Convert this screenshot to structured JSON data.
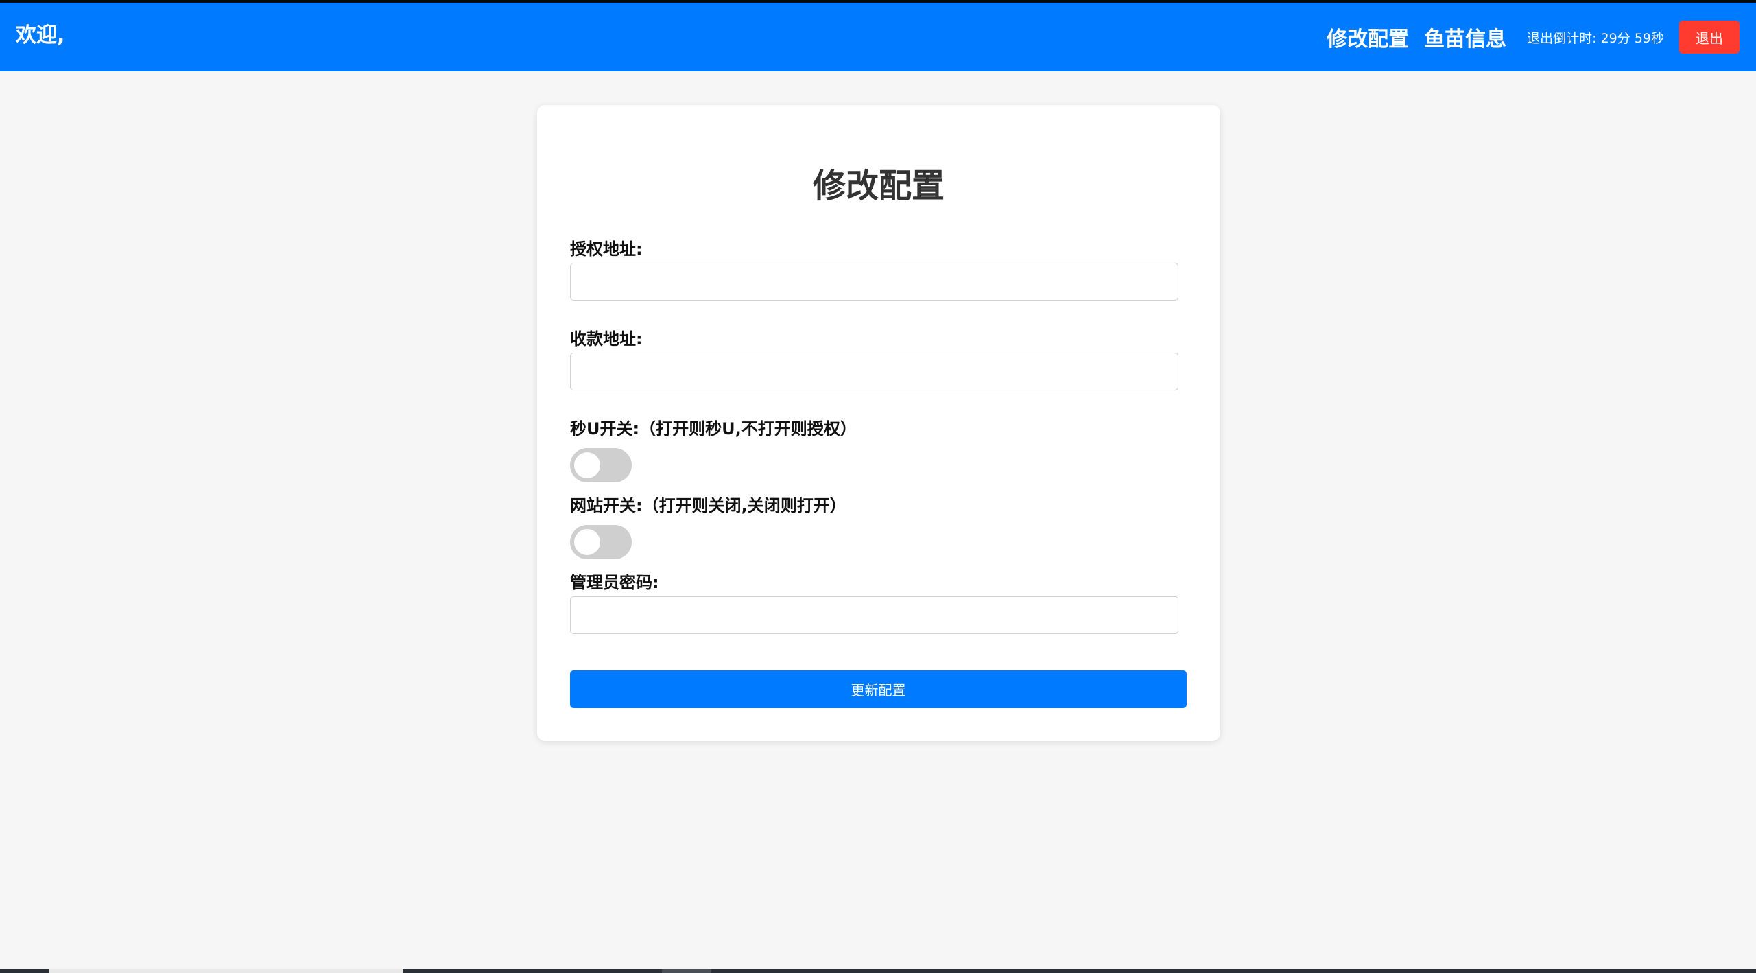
{
  "header": {
    "welcome": "欢迎,",
    "nav_links": [
      "修改配置",
      "鱼苗信息"
    ],
    "countdown": "退出倒计时: 29分 59秒",
    "logout_label": "退出",
    "background_color": "#007bff",
    "logout_color": "#ff3b30"
  },
  "form": {
    "title": "修改配置",
    "auth_address_label": "授权地址:",
    "auth_address_value": "",
    "payee_address_label": "收款地址:",
    "payee_address_value": "",
    "instant_u_label": "秒U开关:（打开则秒U,不打开则授权）",
    "instant_u_on": false,
    "site_switch_label": "网站开关:（打开则关闭,关闭则打开）",
    "site_switch_on": false,
    "admin_password_label": "管理员密码:",
    "admin_password_value": "",
    "submit_label": "更新配置"
  }
}
